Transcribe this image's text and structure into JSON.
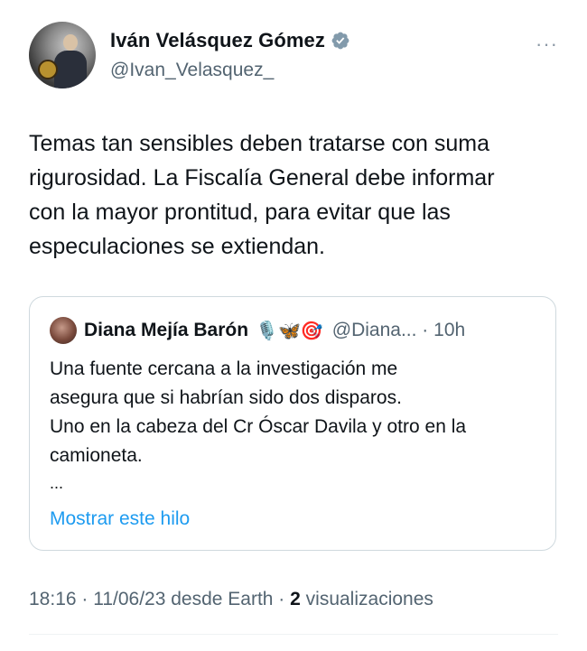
{
  "author": {
    "name": "Iván Velásquez Gómez",
    "handle": "@Ivan_Velasquez_",
    "verified_icon": "verified-badge-icon",
    "badge_color": "#829aab"
  },
  "more_label": "···",
  "tweet": {
    "lines": [
      "Temas tan sensibles deben tratarse con suma",
      "rigurosidad. La Fiscalía General debe informar",
      "con la mayor prontitud, para evitar que las",
      "especulaciones se extiendan."
    ]
  },
  "quote": {
    "name": "Diana Mejía Barón",
    "emojis": "🎙️🦋🎯",
    "handle_time": "@Diana... · 10h",
    "lines": [
      "Una fuente cercana a la investigación me",
      "asegura que si habrían sido dos disparos.",
      "Uno en la cabeza del Cr Óscar Davila y otro en la",
      "camioneta."
    ],
    "ellipsis": "...",
    "show_thread": "Mostrar este hilo"
  },
  "meta": {
    "timestamp": "18:16 · 11/06/23 desde Earth · ",
    "views_count": "2",
    "views_label": " visualizaciones"
  },
  "colors": {
    "link": "#1d9bf0",
    "secondary_text": "#536471",
    "border": "#cfd9de"
  }
}
